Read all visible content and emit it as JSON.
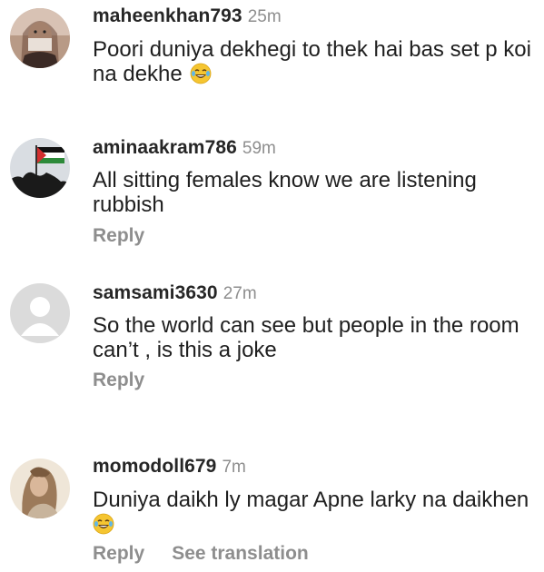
{
  "comments": [
    {
      "username": "maheenkhan793",
      "time": "25m",
      "text": "Poori duniya dekhegi to thek hai bas set p koi na dekhe",
      "emoji_icon": "laughing-tears-emoji-icon"
    },
    {
      "username": "aminaakram786",
      "time": "59m",
      "text": "All sitting females know we are listening rubbish",
      "reply_label": "Reply"
    },
    {
      "username": "samsami3630",
      "time": "27m",
      "text": "So the world can see but people in the room can’t , is this a joke",
      "reply_label": "Reply"
    },
    {
      "username": "momodoll679",
      "time": "7m",
      "text": "Duniya daikh ly magar Apne larky na daikhen",
      "emoji_icon": "laughing-tears-emoji-icon",
      "reply_label": "Reply",
      "translate_label": "See translation"
    }
  ],
  "colors": {
    "username": "#262626",
    "secondary": "#8e8e8e",
    "text": "#1f1f1f",
    "emoji": "#f5c531"
  }
}
